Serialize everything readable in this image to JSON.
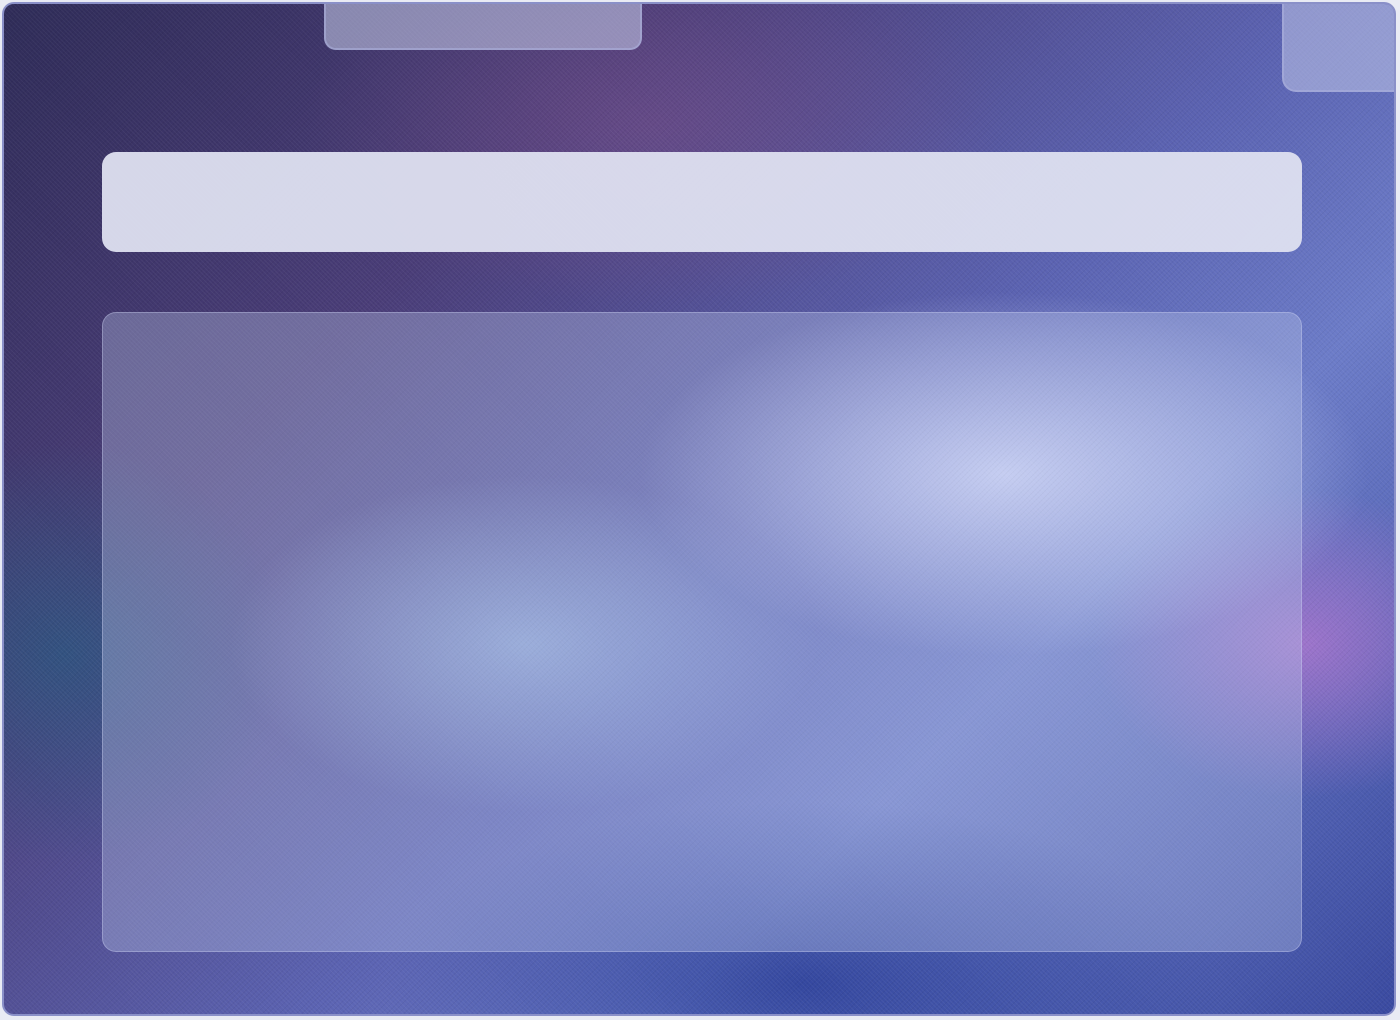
{
  "window": {
    "title": ""
  },
  "top_tab": {
    "label": ""
  },
  "corner_button": {
    "label": ""
  },
  "search": {
    "value": "",
    "placeholder": ""
  },
  "content": {
    "text": ""
  },
  "colors": {
    "frame_border": "#8a90c8",
    "search_bar": "#dee0f0",
    "panel_tint": "#bec8eb"
  }
}
